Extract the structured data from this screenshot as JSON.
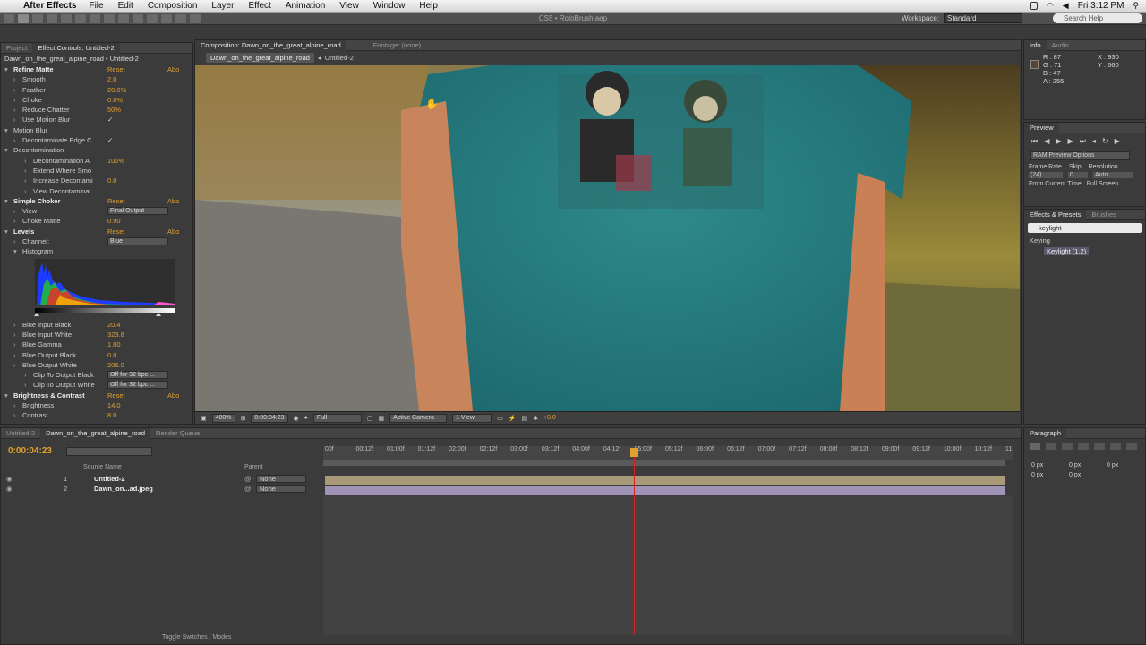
{
  "menubar": {
    "app": "After Effects",
    "items": [
      "File",
      "Edit",
      "Composition",
      "Layer",
      "Effect",
      "Animation",
      "View",
      "Window",
      "Help"
    ],
    "clock": "Fri 3:12 PM"
  },
  "toolbar": {
    "title": "CS5 • RotoBrush.aep",
    "workspace_label": "Workspace:",
    "workspace_value": "Standard",
    "search_placeholder": "Search Help"
  },
  "left_panel": {
    "tabs": [
      "Project",
      "Effect Controls: Untitled-2"
    ],
    "header": "Dawn_on_the_great_alpine_road • Untitled-2",
    "rows": [
      {
        "indent": 1,
        "label": "Refine Matte",
        "reset": "Reset",
        "about": "Abo",
        "bold": true
      },
      {
        "indent": 2,
        "label": "Smooth",
        "value": "2.0"
      },
      {
        "indent": 2,
        "label": "Feather",
        "value": "20.0%"
      },
      {
        "indent": 2,
        "label": "Choke",
        "value": "0.0%"
      },
      {
        "indent": 2,
        "label": "Reduce Chatter",
        "value": "50%"
      },
      {
        "indent": 2,
        "label": "Use Motion Blur",
        "value": "✓",
        "white": true
      },
      {
        "indent": 1,
        "label": "Motion Blur"
      },
      {
        "indent": 2,
        "label": "Decontaminate Edge C",
        "value": "✓",
        "white": true
      },
      {
        "indent": 1,
        "label": "Decontamination"
      },
      {
        "indent": 3,
        "label": "Decontamination A",
        "value": "100%"
      },
      {
        "indent": 3,
        "label": "Extend Where Smo",
        "value": ""
      },
      {
        "indent": 3,
        "label": "Increase Decontami",
        "value": "0.0"
      },
      {
        "indent": 3,
        "label": "View Decontaminat",
        "value": ""
      },
      {
        "indent": 1,
        "label": "Simple Choker",
        "reset": "Reset",
        "about": "Abo",
        "bold": true
      },
      {
        "indent": 2,
        "label": "View",
        "select": "Final Output"
      },
      {
        "indent": 2,
        "label": "Choke Matte",
        "value": "0.90"
      },
      {
        "indent": 1,
        "label": "Levels",
        "reset": "Reset",
        "about": "Abo",
        "bold": true
      },
      {
        "indent": 2,
        "label": "Channel:",
        "select": "Blue"
      },
      {
        "indent": 2,
        "label": "Histogram"
      }
    ],
    "rows2": [
      {
        "indent": 2,
        "label": "Blue Input Black",
        "value": "20.4"
      },
      {
        "indent": 2,
        "label": "Blue Input White",
        "value": "323.8"
      },
      {
        "indent": 2,
        "label": "Blue Gamma",
        "value": "1.00"
      },
      {
        "indent": 2,
        "label": "Blue Output Black",
        "value": "0.0"
      },
      {
        "indent": 2,
        "label": "Blue Output White",
        "value": "206.0"
      },
      {
        "indent": 3,
        "label": "Clip To Output Black",
        "select": "Off for 32 bpc ..."
      },
      {
        "indent": 3,
        "label": "Clip To Output White",
        "select": "Off for 32 bpc ..."
      },
      {
        "indent": 1,
        "label": "Brightness & Contrast",
        "reset": "Reset",
        "about": "Abo",
        "bold": true
      },
      {
        "indent": 2,
        "label": "Brightness",
        "value": "14.0"
      },
      {
        "indent": 2,
        "label": "Contrast",
        "value": "8.0"
      }
    ]
  },
  "composition": {
    "tabs": [
      "Composition: Dawn_on_the_great_alpine_road",
      "Footage: (none)"
    ],
    "breadcrumbs": [
      "Dawn_on_the_great_alpine_road",
      "Untitled-2"
    ],
    "zoom": "400%",
    "timecode": "0:00:04:23",
    "resolution": "Full",
    "camera": "Active Camera",
    "view": "1 View",
    "exposure": "+0.0"
  },
  "info": {
    "tabs": [
      "Info",
      "Audio"
    ],
    "r": "R : 87",
    "g": "G : 71",
    "b": "B : 47",
    "a": "A : 255",
    "x": "X : 930",
    "y": "Y : 660"
  },
  "preview": {
    "title": "Preview",
    "ram": "RAM Preview Options",
    "frame_rate_label": "Frame Rate",
    "skip_label": "Skip",
    "resolution_label": "Resolution",
    "frame_rate": "(24)",
    "skip": "0",
    "resolution": "Auto",
    "from_current": "From Current Time",
    "full_screen": "Full Screen"
  },
  "effects_presets": {
    "tabs": [
      "Effects & Presets",
      "Brushes"
    ],
    "search": "keylight",
    "category": "Keying",
    "item": "Keylight (1.2)"
  },
  "timeline": {
    "tabs": [
      "Untitled-2",
      "Dawn_on_the_great_alpine_road",
      "Render Queue"
    ],
    "timecode": "0:00:04:23",
    "col_source": "Source Name",
    "col_parent": "Parent",
    "layers": [
      {
        "num": "1",
        "name": "Untitled-2",
        "parent": "None"
      },
      {
        "num": "2",
        "name": "Dawn_on...ad.jpeg",
        "parent": "None"
      }
    ],
    "ruler": [
      "00f",
      "00:12f",
      "01:00f",
      "01:12f",
      "02:00f",
      "02:12f",
      "03:00f",
      "03:12f",
      "04:00f",
      "04:12f",
      "05:00f",
      "05:12f",
      "06:00f",
      "06:12f",
      "07:00f",
      "07:12f",
      "08:00f",
      "08:12f",
      "09:00f",
      "09:12f",
      "10:00f",
      "10:12f",
      "11"
    ],
    "footer": "Toggle Switches / Modes"
  },
  "paragraph": {
    "title": "Paragraph",
    "values": [
      "0 px",
      "0 px",
      "0 px",
      "0 px",
      "0 px"
    ]
  }
}
